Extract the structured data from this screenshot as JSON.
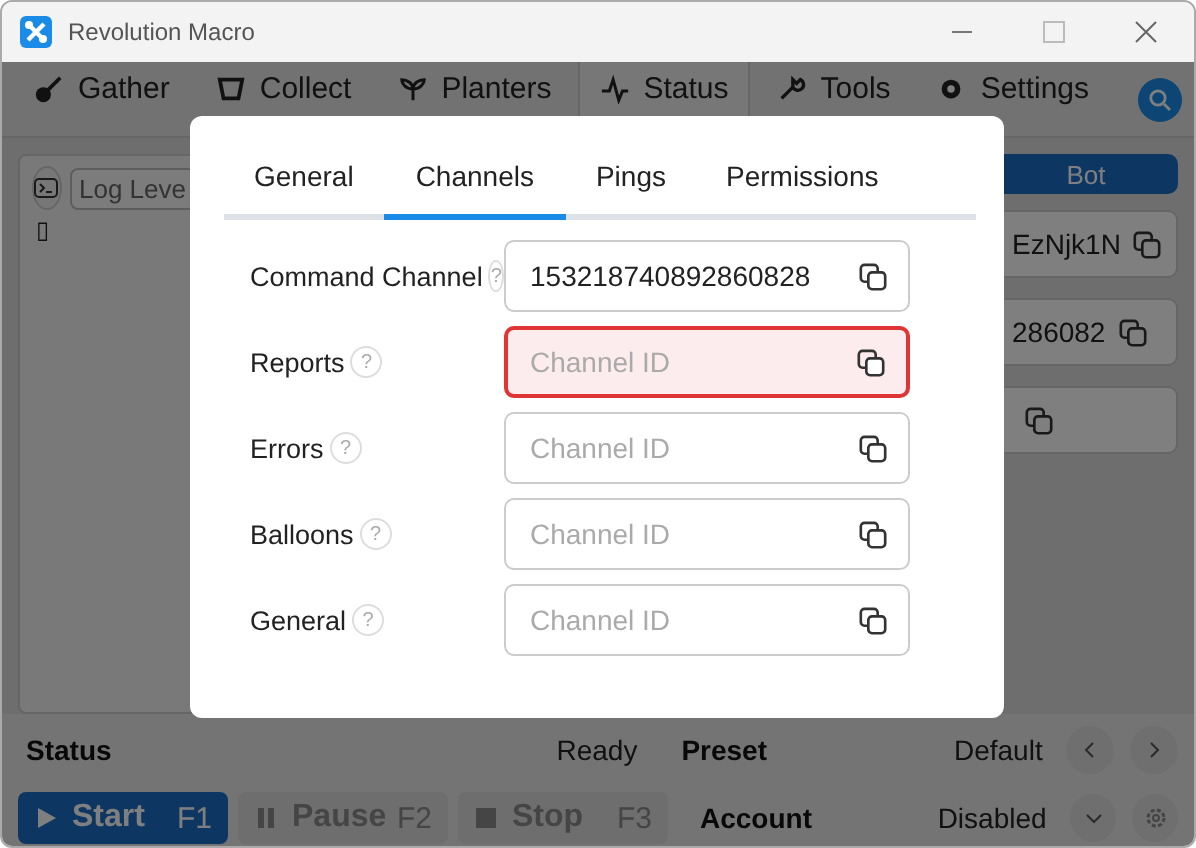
{
  "window": {
    "title": "Revolution Macro"
  },
  "nav_tabs": [
    {
      "label": "Gather",
      "selected": false
    },
    {
      "label": "Collect",
      "selected": false
    },
    {
      "label": "Planters",
      "selected": false
    },
    {
      "label": "Status",
      "selected": true
    },
    {
      "label": "Tools",
      "selected": false
    },
    {
      "label": "Settings",
      "selected": false
    }
  ],
  "log_toolbar": {
    "log_level": {
      "placeholder": "Log Leve"
    },
    "cursor": "▯"
  },
  "bot_button": "Bot",
  "background_fields": [
    {
      "kind": "filled",
      "value": "EzNjk1N"
    },
    {
      "kind": "filled",
      "value": "286082"
    },
    {
      "kind": "blank"
    }
  ],
  "dialog": {
    "tabs": [
      {
        "label": "General",
        "selected": false
      },
      {
        "label": "Channels",
        "selected": true
      },
      {
        "label": "Pings",
        "selected": false
      },
      {
        "label": "Permissions",
        "selected": false
      }
    ],
    "channels": [
      {
        "label": "Command Channel",
        "help": "?",
        "value": "153218740892860828",
        "error": false
      },
      {
        "label": "Reports",
        "help": "?",
        "placeholder": "Channel ID",
        "error": true
      },
      {
        "label": "Errors",
        "help": "?",
        "placeholder": "Channel ID",
        "error": false
      },
      {
        "label": "Balloons",
        "help": "?",
        "placeholder": "Channel ID",
        "error": false
      },
      {
        "label": "General",
        "help": "?",
        "placeholder": "Channel ID",
        "error": false
      }
    ]
  },
  "status_bar": {
    "status_label": "Status",
    "status_value": "Ready",
    "preset_label": "Preset",
    "preset_value": "Default",
    "account_label": "Account",
    "account_value": "Disabled",
    "buttons": [
      {
        "label": "Start",
        "key": "F1",
        "kind": "primary"
      },
      {
        "label": "Pause",
        "key": "F2",
        "kind": "secondary"
      },
      {
        "label": "Stop",
        "key": "F3",
        "kind": "secondary"
      }
    ]
  }
}
